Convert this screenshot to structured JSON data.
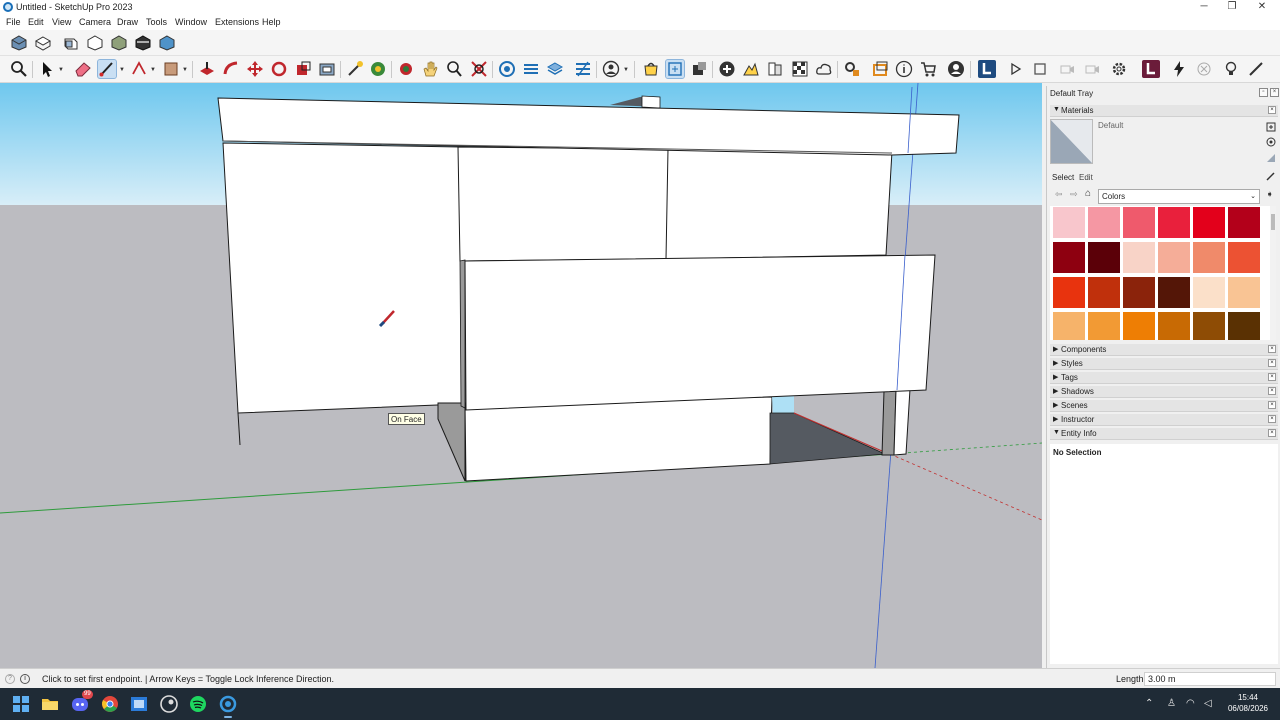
{
  "window": {
    "title": "Untitled - SketchUp Pro 2023",
    "controls": [
      "─",
      "❐",
      "✕"
    ]
  },
  "menu": [
    "File",
    "Edit",
    "View",
    "Camera",
    "Draw",
    "Tools",
    "Window",
    "Extensions",
    "Help"
  ],
  "toolbar_row1": [
    "iso-view",
    "top-view",
    "front-view",
    "right-view",
    "back-view",
    "left-view",
    "bottom-view"
  ],
  "toolbar_row2": {
    "active_tool": "paint-bucket",
    "tools": [
      "zoom",
      "select",
      "eraser",
      "paint-bucket",
      "shape",
      "arc",
      "push-pull",
      "follow-me",
      "move",
      "rotate",
      "scale",
      "offset",
      "tape-measure",
      "protractor",
      "axes",
      "text",
      "orbit",
      "pan",
      "zoom-extents",
      "section-plane",
      "warehouse",
      "extension-warehouse"
    ]
  },
  "viewport": {
    "tooltip": "On Face",
    "colors": {
      "sky": "#8fd6f3",
      "ground": "#bcbcc1",
      "face": "#ffffff",
      "shade": "#9a9a9a",
      "dark": "#555a61"
    }
  },
  "tray": {
    "title": "Default Tray",
    "materials": {
      "header": "Materials",
      "current": "Default",
      "tabs": [
        "Select",
        "Edit"
      ],
      "collection": "Colors",
      "swatches": [
        [
          "#f8c6cc",
          "#f597a3",
          "#ef5a6c",
          "#e9203c",
          "#e3001b",
          "#b3001a"
        ],
        [
          "#8e0010",
          "#5b0008",
          "#f8d3c7",
          "#f5ad98",
          "#f08a6a",
          "#ec5233"
        ],
        [
          "#e8330e",
          "#c0300c",
          "#8b230b",
          "#541607",
          "#fbe0c9",
          "#f9c494"
        ],
        [
          "#f6b36a",
          "#f29a34",
          "#ee7e04",
          "#c86a04",
          "#8e4c05",
          "#5a3103"
        ]
      ]
    },
    "panels": [
      "Components",
      "Styles",
      "Tags",
      "Shadows",
      "Scenes",
      "Instructor",
      "Entity Info"
    ],
    "entity_info": {
      "status": "No Selection"
    }
  },
  "status": {
    "message": "Click to set first endpoint. | Arrow Keys = Toggle Lock Inference Direction.",
    "length_label": "Length",
    "length_value": "3.00 m"
  },
  "taskbar": {
    "apps": [
      "windows-start",
      "file-explorer",
      "discord",
      "chrome",
      "visual-studio",
      "steam",
      "spotify",
      "sketchup"
    ],
    "discord_badge": "99",
    "time": "15:44",
    "date": "06/08/2026"
  }
}
